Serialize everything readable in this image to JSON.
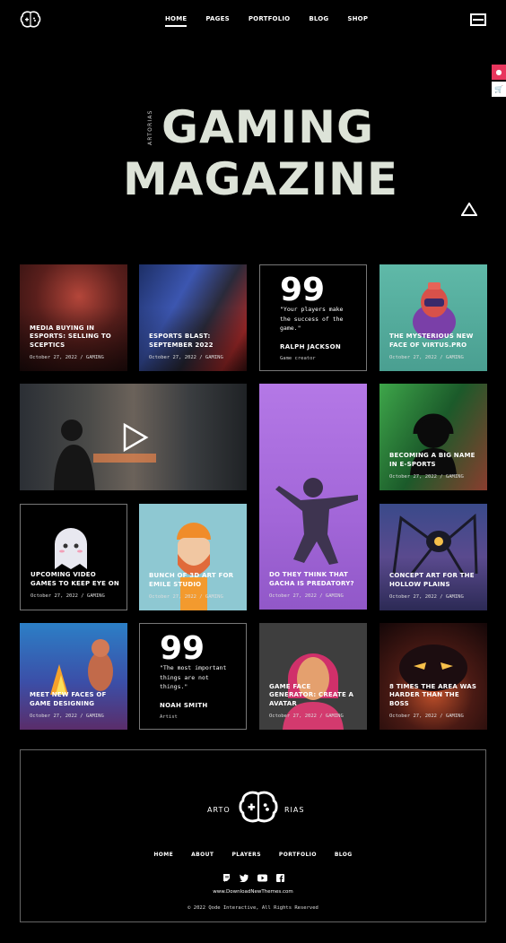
{
  "nav": {
    "items": [
      "HOME",
      "PAGES",
      "PORTFOLIO",
      "BLOG",
      "SHOP"
    ],
    "active": "HOME"
  },
  "hero": {
    "side_label": "ARTORIAS",
    "line1": "GAMING",
    "line2": "MAGAZINE"
  },
  "cards": [
    {
      "title": "MEDIA BUYING IN ESPORTS: SELLING TO SCEPTICS",
      "meta": "October 27, 2022  /  GAMING"
    },
    {
      "title": "ESPORTS BLAST: SEPTEMBER 2022",
      "meta": "October 27, 2022  /  GAMING"
    },
    {
      "title": "THE MYSTERIOUS NEW FACE OF VIRTUS.PRO",
      "meta": "October 27, 2022  /  GAMING"
    },
    {
      "title": "BECOMING A BIG NAME IN E-SPORTS",
      "meta": "October 27, 2022  /  GAMING"
    },
    {
      "title": "UPCOMING VIDEO GAMES TO KEEP EYE ON",
      "meta": "October 27, 2022  /  GAMING"
    },
    {
      "title": "BUNCH OF 3D ART FOR EMILE STUDIO",
      "meta": "October 27, 2022  /  GAMING"
    },
    {
      "title": "DO THEY THINK THAT GACHA IS PREDATORY?",
      "meta": "October 27, 2022  /  GAMING"
    },
    {
      "title": "CONCEPT ART FOR THE HOLLOW PLAINS",
      "meta": "October 27, 2022  /  GAMING"
    },
    {
      "title": "MEET NEW FACES OF GAME DESIGNING",
      "meta": "October 27, 2022  /  GAMING"
    },
    {
      "title": "GAME FACE GENERATOR: CREATE A AVATAR",
      "meta": "October 27, 2022  /  GAMING"
    },
    {
      "title": "8 TIMES THE AREA WAS HARDER THAN THE BOSS",
      "meta": "October 27, 2022  /  GAMING"
    }
  ],
  "quotes": [
    {
      "mark": "99",
      "text": "\"Your players make the success of the game.\"",
      "name": "RALPH JACKSON",
      "role": "Game creator"
    },
    {
      "mark": "99",
      "text": "\"The most important things are not things.\"",
      "name": "NOAH SMITH",
      "role": "Artist"
    }
  ],
  "footer": {
    "logo_left": "ARTO",
    "logo_right": "RIAS",
    "nav": [
      "HOME",
      "ABOUT",
      "PLAYERS",
      "PORTFOLIO",
      "BLOG"
    ],
    "social_icons": [
      "twitch-icon",
      "twitter-icon",
      "youtube-icon",
      "facebook-icon"
    ],
    "site": "www.DownloadNewThemes.com",
    "copyright": "© 2022 Qode Interactive, All Rights Reserved"
  },
  "colors": {
    "accent": "#e8365d",
    "purple": "#b77fe0",
    "teal": "#5fb6a6",
    "hero_text": "#dde3d8"
  }
}
